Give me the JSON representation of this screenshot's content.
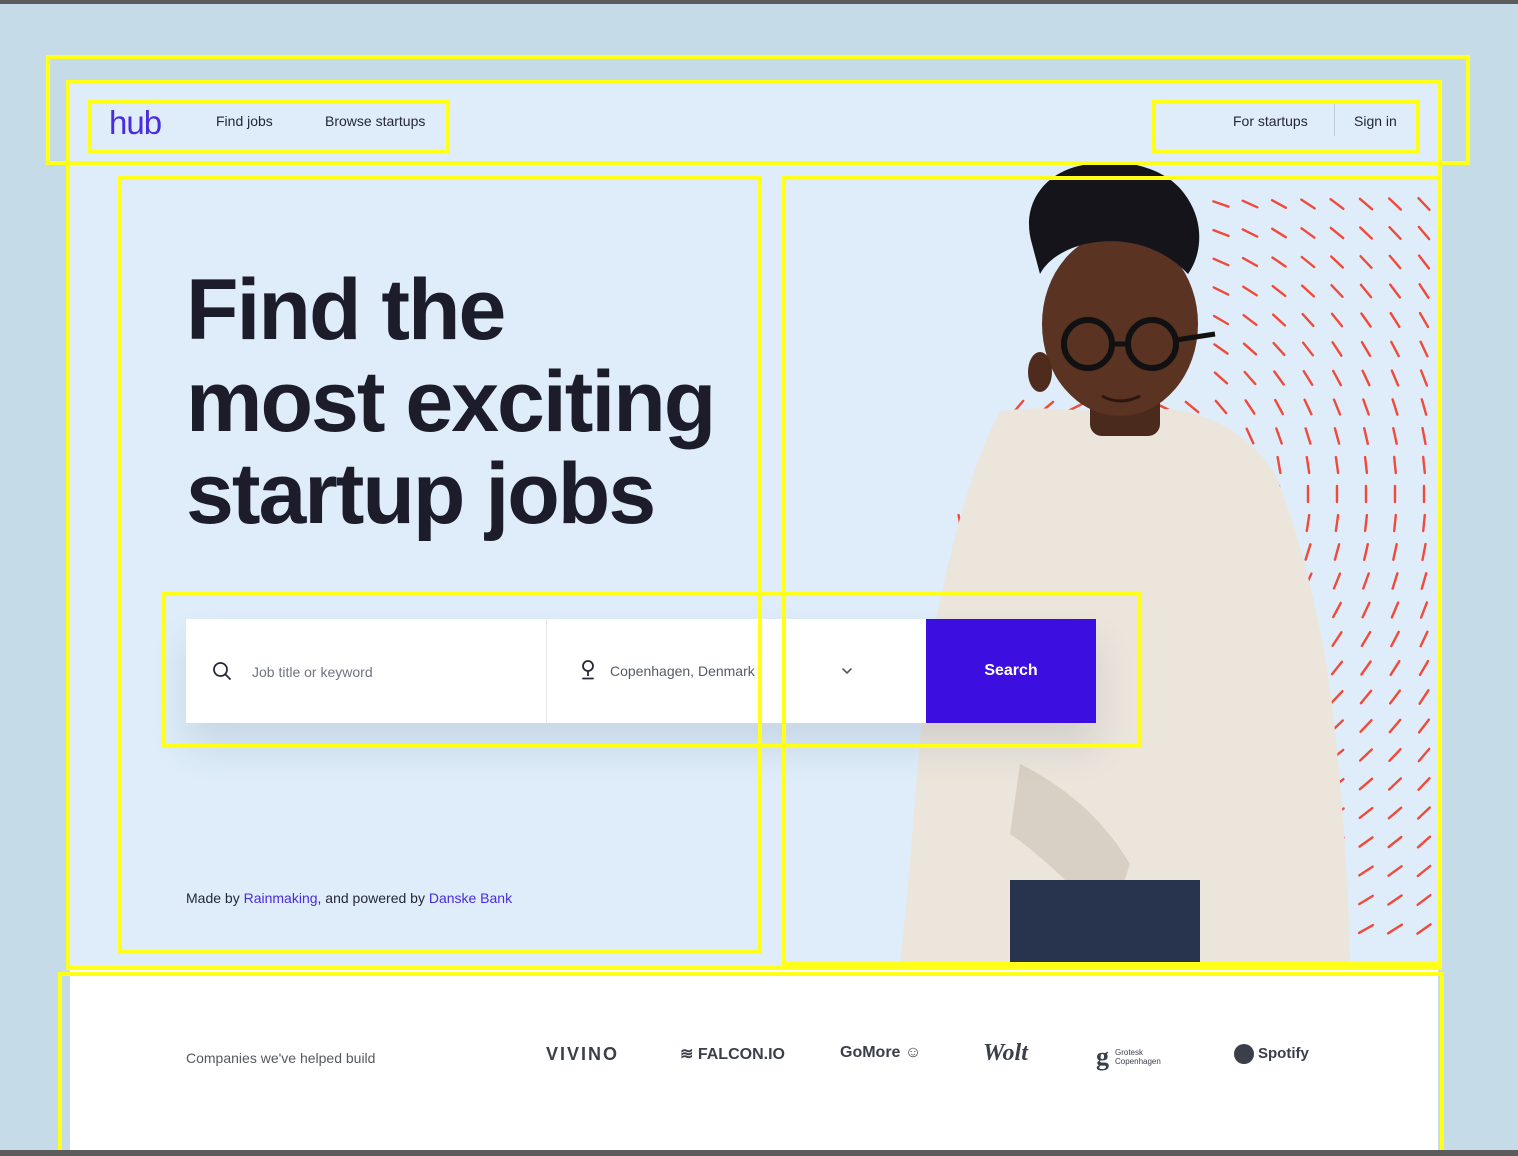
{
  "header": {
    "logo": "hub",
    "nav_left": [
      "Find jobs",
      "Browse startups"
    ],
    "nav_right": [
      "For startups",
      "Sign in"
    ]
  },
  "hero": {
    "headline_lines": [
      "Find the",
      "most exciting",
      "startup jobs"
    ],
    "search": {
      "keyword_placeholder": "Job title or keyword",
      "location_value": "Copenhagen, Denmark",
      "button_label": "Search"
    },
    "credit": {
      "prefix": "Made by ",
      "maker": "Rainmaking",
      "middle": ", and powered by ",
      "partner": "Danske Bank"
    }
  },
  "companies": {
    "label": "Companies we've helped build",
    "logos": {
      "vivino": "VIVINO",
      "falcon": "FALCON.IO",
      "gomore": "GoMore",
      "wolt": "Wolt",
      "grotesk_mark": "g",
      "grotesk_name_1": "Grotesk",
      "grotesk_name_2": "Copenhagen",
      "spotify": "Spotify"
    }
  },
  "colors": {
    "brand": "#4a2be0",
    "button": "#3c0fe0",
    "hero_bg": "#deedf9",
    "highlight": "#ffff18",
    "pattern": "#ef4a3a"
  },
  "icons": [
    "search-icon",
    "location-pin-icon",
    "chevron-down-icon"
  ]
}
